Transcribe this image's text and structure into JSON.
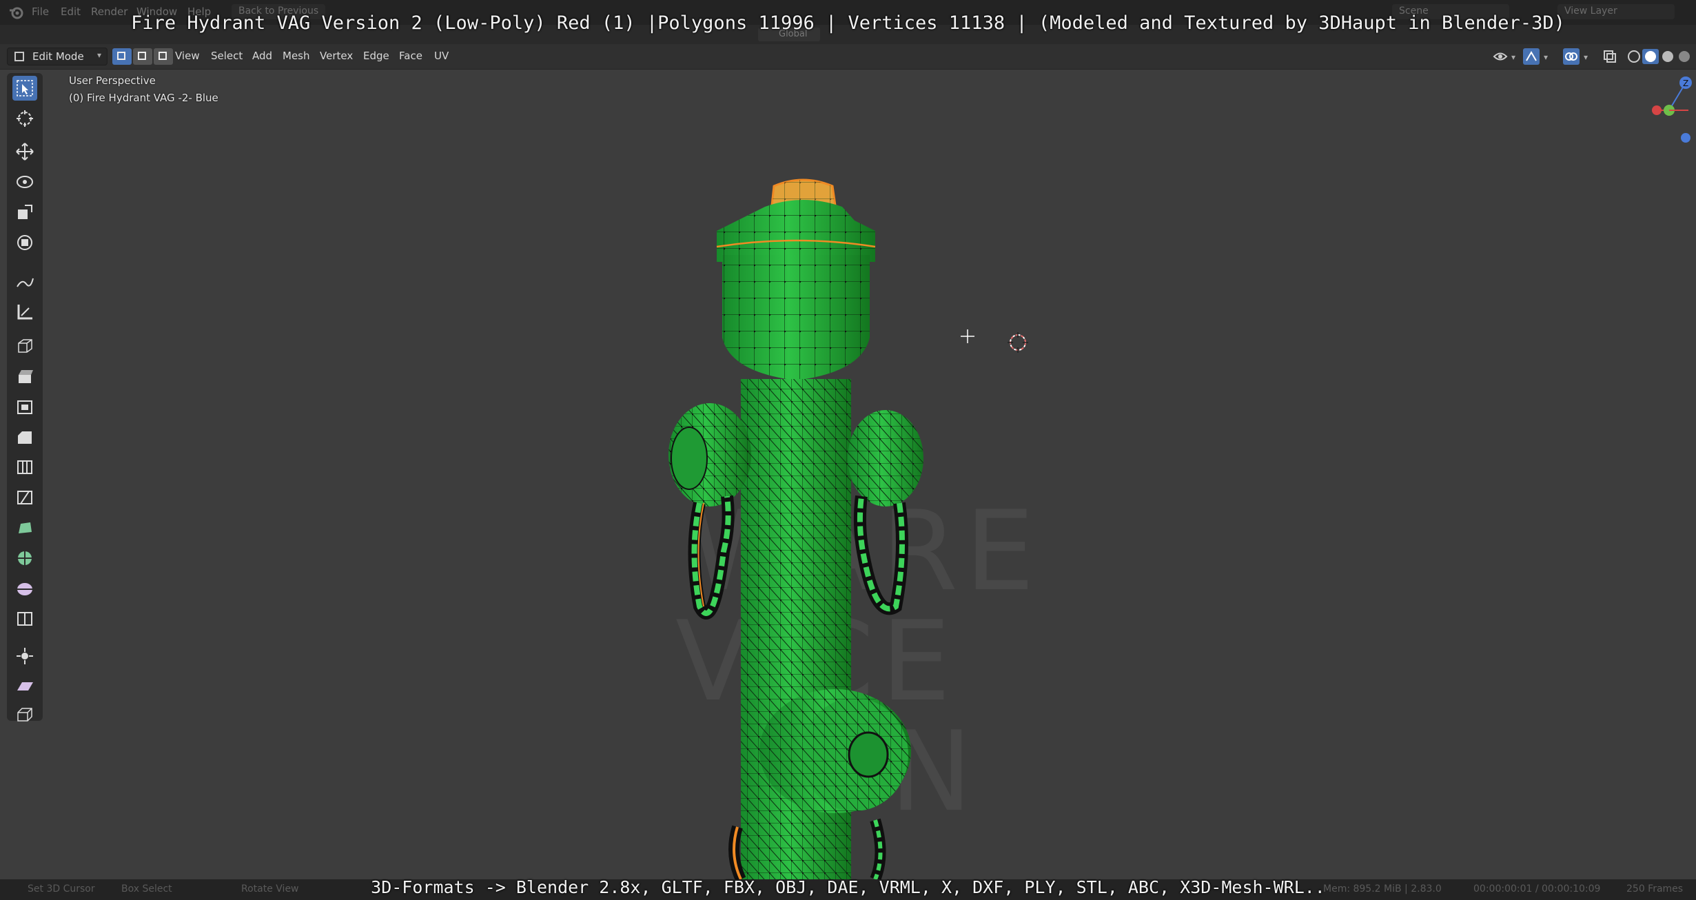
{
  "overlay_title": "Fire Hydrant VAG Version 2 (Low-Poly) Red (1) |Polygons 11996 | Vertices 11138 | (Modeled and Textured by 3DHaupt in Blender-3D)",
  "overlay_bottom": "3D-Formats -> Blender 2.8x, GLTF, FBX, OBJ, DAE, VRML, X, DXF, PLY, STL, ABC, X3D-Mesh-WRL..",
  "top_menu": {
    "file": "File",
    "edit": "Edit",
    "render": "Render",
    "window": "Window",
    "help": "Help",
    "back": "Back to Previous",
    "scene": "Scene",
    "view_layer": "View Layer"
  },
  "header": {
    "mode": "Edit Mode",
    "menus": {
      "view": "View",
      "select": "Select",
      "add": "Add",
      "mesh": "Mesh",
      "vertex": "Vertex",
      "edge": "Edge",
      "face": "Face",
      "uv": "UV"
    },
    "transform_orientation": "Global"
  },
  "viewport": {
    "perspective_label": "User Perspective",
    "object_label": "(0) Fire Hydrant VAG -2- Blue"
  },
  "watermark": {
    "line1": "WARE",
    "line2": "VICE",
    "line3": "H N"
  },
  "status": {
    "left1": "Set 3D Cursor",
    "left2": "Box Select",
    "left3": "Rotate View",
    "mem": "Mem: 895.2 MiB | 2.83.0",
    "time": "00:00:00:01 / 00:00:10:09",
    "frames": "250 Frames"
  },
  "colors": {
    "accent": "#4772b3",
    "mesh_green": "#22a83a",
    "selected_orange": "#f08a24"
  },
  "icons": [
    "blender-logo-icon",
    "select-box-icon",
    "cursor-icon",
    "move-icon",
    "rotate-icon",
    "scale-icon",
    "transform-icon",
    "annotate-icon",
    "measure-icon",
    "add-cube-icon",
    "extrude-icon",
    "inset-icon",
    "bevel-icon",
    "loop-cut-icon",
    "knife-icon",
    "poly-build-icon",
    "spin-icon",
    "smooth-icon",
    "edge-slide-icon",
    "shrink-icon",
    "shear-icon",
    "rip-icon"
  ]
}
